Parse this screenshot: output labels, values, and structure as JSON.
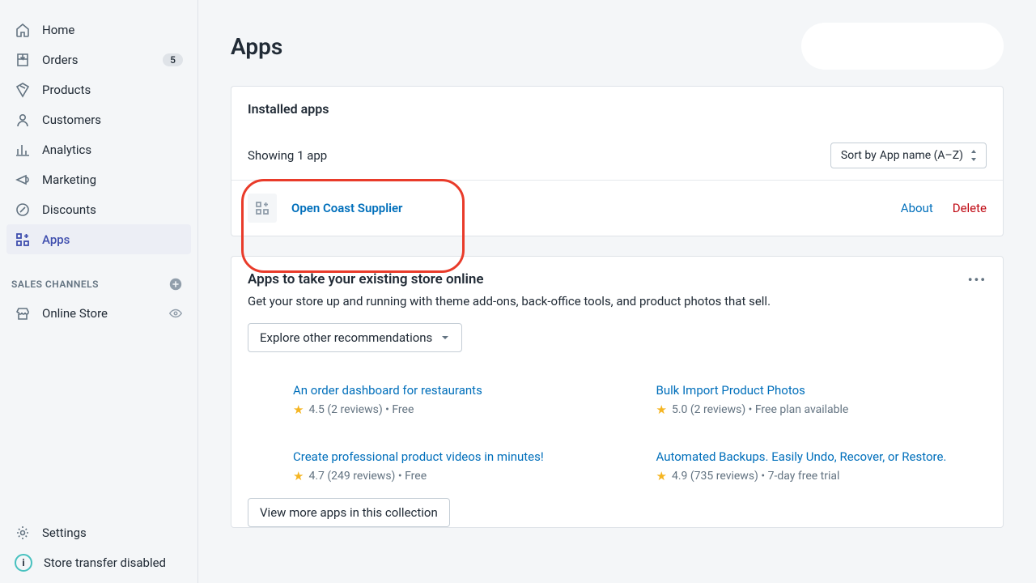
{
  "sidebar": {
    "items": [
      {
        "label": "Home",
        "icon": "home-icon"
      },
      {
        "label": "Orders",
        "icon": "orders-icon",
        "badge": "5"
      },
      {
        "label": "Products",
        "icon": "products-icon"
      },
      {
        "label": "Customers",
        "icon": "customers-icon"
      },
      {
        "label": "Analytics",
        "icon": "analytics-icon"
      },
      {
        "label": "Marketing",
        "icon": "marketing-icon"
      },
      {
        "label": "Discounts",
        "icon": "discounts-icon"
      },
      {
        "label": "Apps",
        "icon": "apps-icon"
      }
    ],
    "section_header": "SALES CHANNELS",
    "channels": [
      {
        "label": "Online Store",
        "icon": "online-store-icon"
      }
    ],
    "settings_label": "Settings",
    "transfer_label": "Store transfer disabled"
  },
  "page": {
    "title": "Apps"
  },
  "installed": {
    "heading": "Installed apps",
    "showing": "Showing 1 app",
    "sort_prefix": "Sort by",
    "sort_value": "App name (A–Z)",
    "app_name": "Open Coast Supplier",
    "about": "About",
    "delete": "Delete"
  },
  "recommend": {
    "heading": "Apps to take your existing store online",
    "sub": "Get your store up and running with theme add-ons, back-office tools, and product photos that sell.",
    "explore": "Explore other recommendations",
    "items": [
      {
        "title": "An order dashboard for restaurants",
        "rating": "4.5",
        "reviews": "(2 reviews)",
        "extra": "Free"
      },
      {
        "title": "Bulk Import Product Photos",
        "rating": "5.0",
        "reviews": "(2 reviews)",
        "extra": "Free plan available"
      },
      {
        "title": "Create professional product videos in minutes!",
        "rating": "4.7",
        "reviews": "(249 reviews)",
        "extra": "Free"
      },
      {
        "title": "Automated Backups. Easily Undo, Recover, or Restore.",
        "rating": "4.9",
        "reviews": "(735 reviews)",
        "extra": "7-day free trial"
      }
    ],
    "view_more": "View more apps in this collection"
  }
}
